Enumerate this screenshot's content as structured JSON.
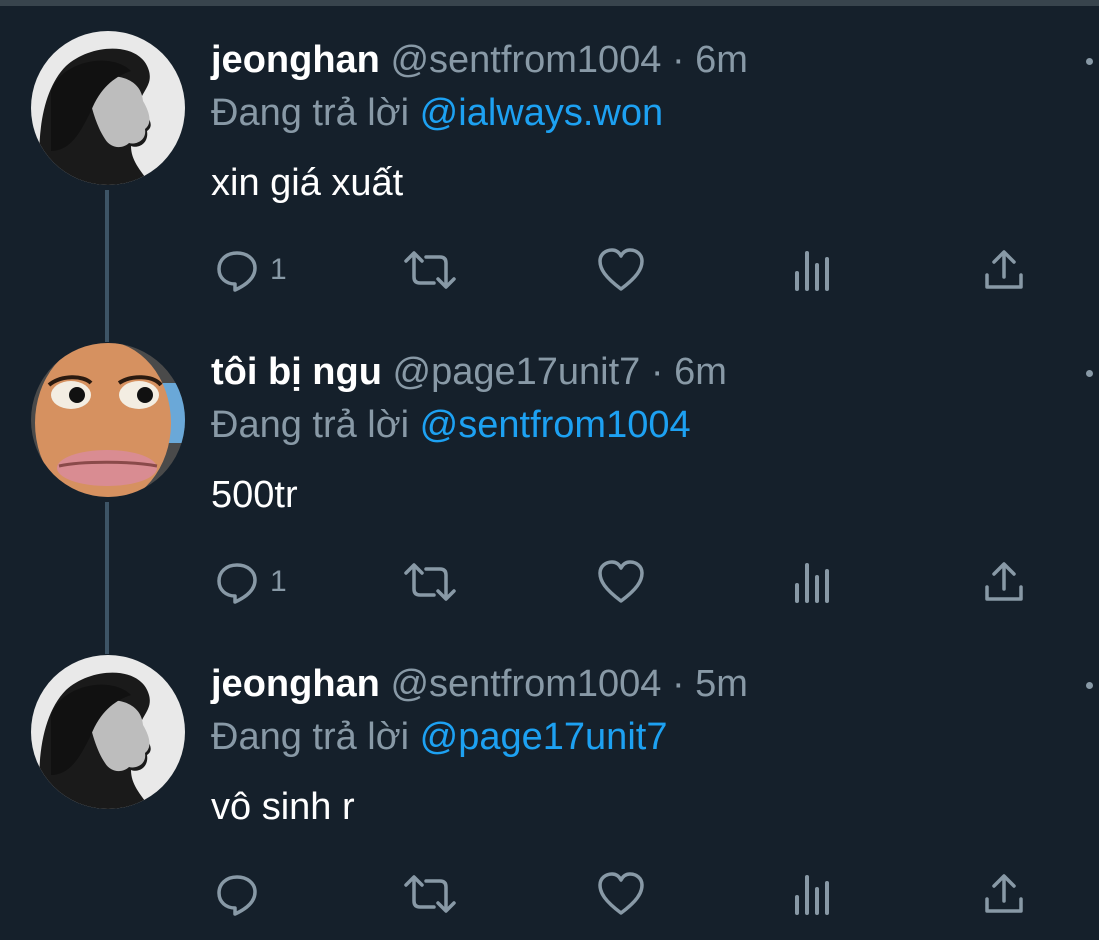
{
  "tweets": [
    {
      "name": "jeonghan",
      "handle": "@sentfrom1004",
      "separator": "·",
      "time": "6m",
      "reply_prefix": "Đang trả lời",
      "reply_to": "@ialways.won",
      "text": "xin giá xuất",
      "reply_count": "1",
      "avatar": "monochrome-portrait"
    },
    {
      "name": "tôi bị ngu",
      "handle": "@page17unit7",
      "separator": "·",
      "time": "6m",
      "reply_prefix": "Đang trả lời",
      "reply_to": "@sentfrom1004",
      "text": "500tr",
      "reply_count": "1",
      "avatar": "cartoon-face"
    },
    {
      "name": "jeonghan",
      "handle": "@sentfrom1004",
      "separator": "·",
      "time": "5m",
      "reply_prefix": "Đang trả lời",
      "reply_to": "@page17unit7",
      "text": "vô sinh r",
      "reply_count": "",
      "avatar": "monochrome-portrait"
    }
  ],
  "actions": [
    "reply-icon",
    "retweet-icon",
    "like-icon",
    "analytics-icon",
    "share-icon"
  ],
  "colors": {
    "background": "#15202b",
    "name": "#ffffff",
    "secondary": "#8899a6",
    "mention": "#1da1f2",
    "thread_line": "#3d5466"
  }
}
